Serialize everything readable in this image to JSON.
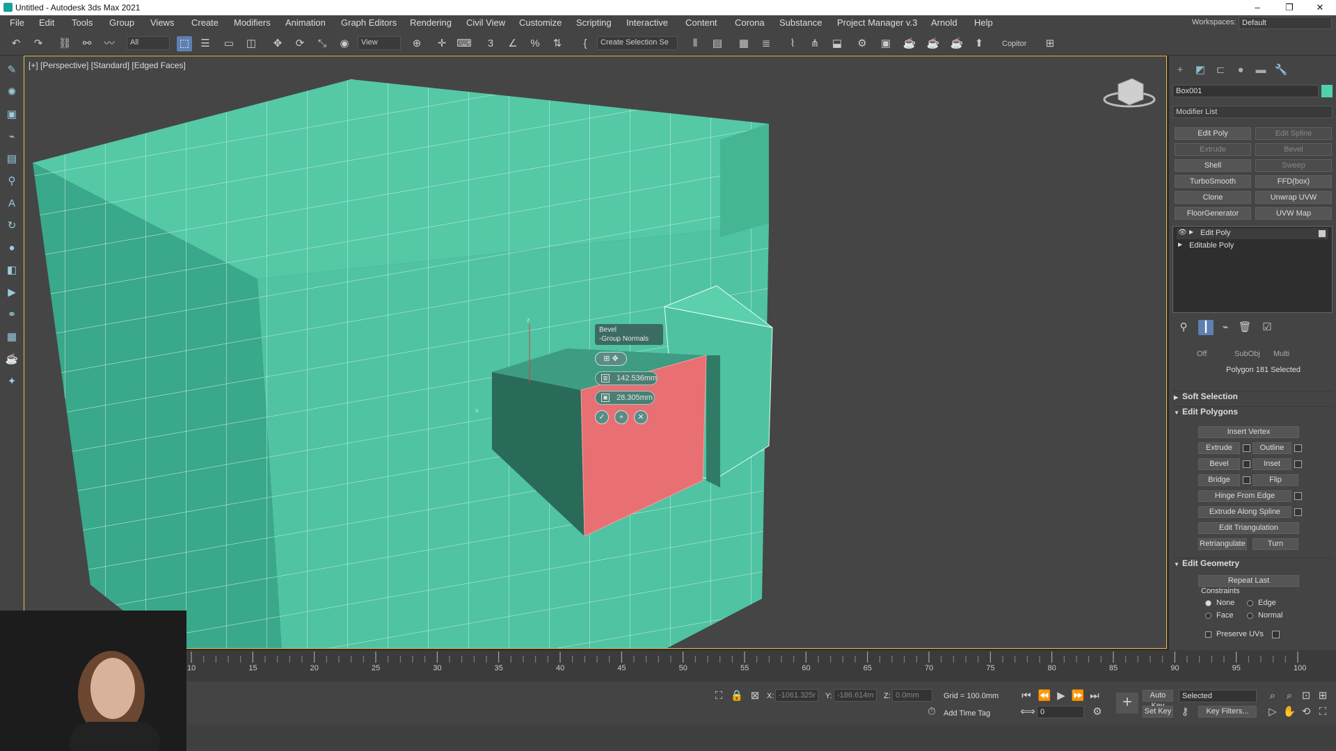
{
  "window": {
    "title": "Untitled - Autodesk 3ds Max 2021",
    "minimize": "–",
    "maximize": "❐",
    "close": "✕"
  },
  "menu": {
    "items": [
      "File",
      "Edit",
      "Tools",
      "Group",
      "Views",
      "Create",
      "Modifiers",
      "Animation",
      "Graph Editors",
      "Rendering",
      "Civil View",
      "Customize",
      "Scripting",
      "Interactive",
      "Content",
      "Corona",
      "Substance",
      "Project Manager v.3",
      "Arnold",
      "Help"
    ],
    "workspaces_label": "Workspaces:",
    "workspaces_value": "Default"
  },
  "toolbar": {
    "filter_value": "All",
    "refcoord_value": "View",
    "selection_set_placeholder": "Create Selection Se",
    "copitor_label": "Copitor",
    "snaps_label": "3",
    "angle_snap_label": "∠",
    "percent_snap_label": "%"
  },
  "viewport": {
    "label": "[+] [Perspective] [Standard] [Edged Faces]",
    "caddy": {
      "title_line1": "Bevel",
      "title_line2": "-Group Normals",
      "height_value": "142.536mm",
      "outline_value": "28.305mm",
      "ok": "✓",
      "apply": "+",
      "cancel": "✕"
    }
  },
  "command_panel": {
    "object_name": "Box001",
    "object_color": "#4fd1ae",
    "modifier_list": "Modifier List",
    "modifier_buttons": [
      {
        "label": "Edit Poly",
        "enabled": true
      },
      {
        "label": "Edit Spline",
        "enabled": false
      },
      {
        "label": "Extrude",
        "enabled": false
      },
      {
        "label": "Bevel",
        "enabled": false
      },
      {
        "label": "Shell",
        "enabled": true
      },
      {
        "label": "Sweep",
        "enabled": false
      },
      {
        "label": "TurboSmooth",
        "enabled": true
      },
      {
        "label": "FFD(box)",
        "enabled": true
      },
      {
        "label": "Clone",
        "enabled": true
      },
      {
        "label": "Unwrap UVW",
        "enabled": true
      },
      {
        "label": "FloorGenerator",
        "enabled": true
      },
      {
        "label": "UVW Map",
        "enabled": true
      }
    ],
    "stack": [
      "Edit Poly",
      "Editable Poly"
    ],
    "subobj_row": [
      "Off",
      "SubObj",
      "Multi"
    ],
    "selection_info": "Polygon 181 Selected",
    "soft_selection": "Soft Selection",
    "edit_polygons": {
      "header": "Edit Polygons",
      "insert_vertex": "Insert Vertex",
      "extrude": "Extrude",
      "outline": "Outline",
      "bevel": "Bevel",
      "inset": "Inset",
      "bridge": "Bridge",
      "flip": "Flip",
      "hinge": "Hinge From Edge",
      "extrude_spline": "Extrude Along Spline",
      "edit_tri": "Edit Triangulation",
      "retriangulate": "Retriangulate",
      "turn": "Turn"
    },
    "edit_geometry": {
      "header": "Edit Geometry",
      "repeat_last": "Repeat Last",
      "constraints": "Constraints",
      "none": "None",
      "edge": "Edge",
      "face": "Face",
      "normal": "Normal",
      "preserve_uvs": "Preserve UVs"
    }
  },
  "timeline": {
    "ticks": [
      "10",
      "15",
      "20",
      "25",
      "30",
      "35",
      "40",
      "45",
      "50",
      "55",
      "60",
      "65",
      "70",
      "75",
      "80",
      "85",
      "90",
      "95",
      "100"
    ]
  },
  "status": {
    "x_label": "X:",
    "x_value": "-1061.325r",
    "y_label": "Y:",
    "y_value": "-186.614m",
    "z_label": "Z:",
    "z_value": "0.0mm",
    "grid": "Grid = 100.0mm",
    "add_time_tag": "Add Time Tag",
    "frame_value": "0",
    "auto_key": "Auto Key",
    "set_key": "Set Key",
    "selected": "Selected",
    "key_filters": "Key Filters..."
  }
}
